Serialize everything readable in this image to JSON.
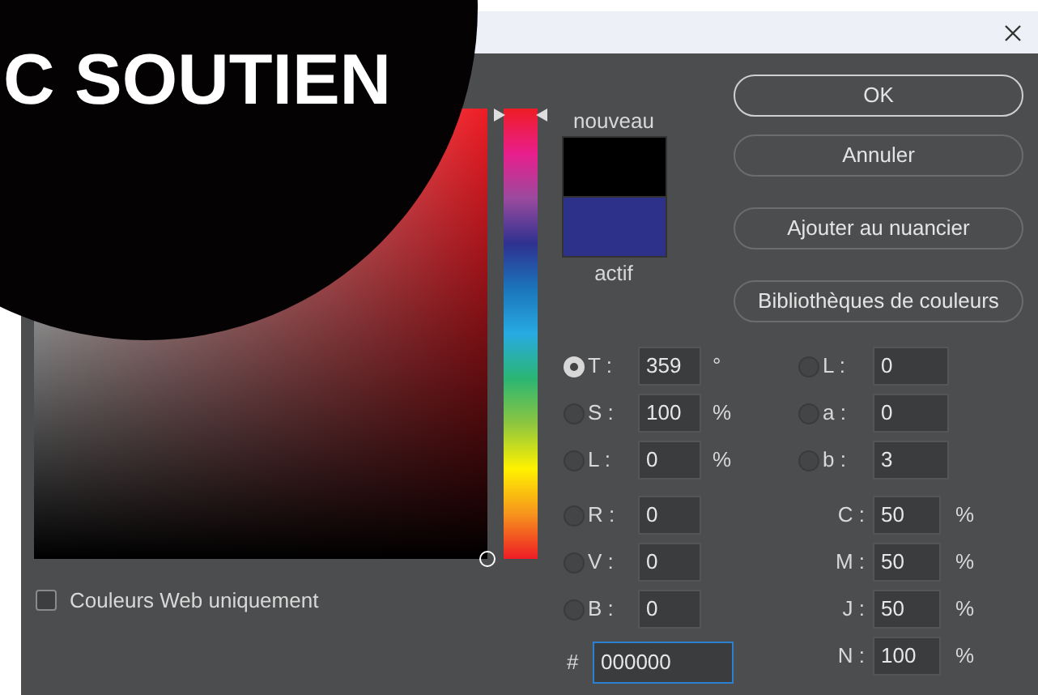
{
  "banner": {
    "text": "C SOUTIEN"
  },
  "swatches": [
    {
      "label": "nouveau",
      "color": "#000000"
    },
    {
      "label": "actif",
      "color": "#2d3189"
    }
  ],
  "hue_slider": {
    "level": 0.997
  },
  "buttons": [
    {
      "label": "OK",
      "default": true
    },
    {
      "label": "Annuler",
      "default": false
    },
    {
      "label": "Ajouter au nuancier",
      "default": false
    },
    {
      "label": "Bibliothèques de couleurs",
      "default": false
    }
  ],
  "web_colors_only": {
    "label": "Couleurs Web uniquement",
    "checked": false
  },
  "hsb_rgb_fields": [
    {
      "label": "T :",
      "value": "359",
      "unit": "°",
      "selected": true
    },
    {
      "label": "S :",
      "value": "100",
      "unit": "%",
      "selected": false
    },
    {
      "label": "L :",
      "value": "0",
      "unit": "%",
      "selected": false
    },
    {
      "label": "R :",
      "value": "0",
      "selected": false
    },
    {
      "label": "V :",
      "value": "0",
      "selected": false
    },
    {
      "label": "B :",
      "value": "0",
      "selected": false
    }
  ],
  "lab_fields": [
    {
      "label": "L :",
      "value": "0",
      "selected": false
    },
    {
      "label": "a :",
      "value": "0",
      "selected": false
    },
    {
      "label": "b :",
      "value": "3",
      "selected": false
    }
  ],
  "cmyk_fields": [
    {
      "label": "C :",
      "value": "50",
      "unit": "%"
    },
    {
      "label": "M :",
      "value": "50",
      "unit": "%"
    },
    {
      "label": "J :",
      "value": "50",
      "unit": "%"
    },
    {
      "label": "N :",
      "value": "100",
      "unit": "%"
    }
  ],
  "hex_field": {
    "label": "#",
    "value": "000000"
  }
}
